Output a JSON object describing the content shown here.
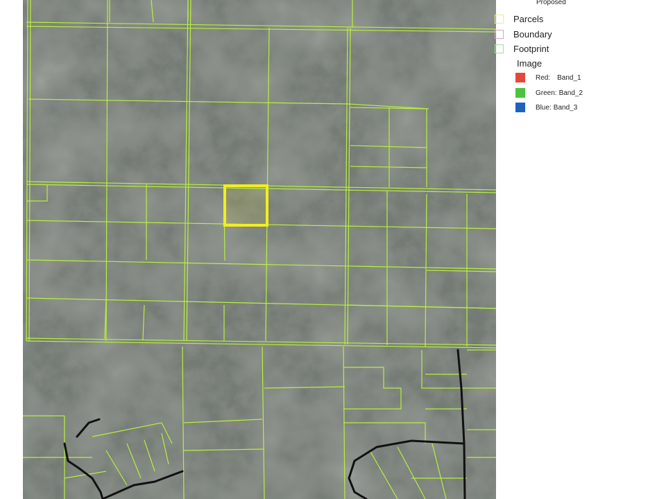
{
  "legend": {
    "title": "Proposed",
    "layers": [
      {
        "label": "Parcels",
        "color": "#eef07a"
      },
      {
        "label": "Boundary",
        "color": "#d8a4c8"
      },
      {
        "label": "Footprint",
        "color": "#9ee09e"
      }
    ],
    "image_heading": "Image",
    "bands": [
      {
        "channel": "Red:",
        "band": "Band_1",
        "color": "#e2493a"
      },
      {
        "channel": "Green:",
        "band": "Band_2",
        "color": "#4cc43c"
      },
      {
        "channel": "Blue:",
        "band": "Band_3",
        "color": "#1f62c0"
      }
    ]
  },
  "map": {
    "parcel_line_color": "#b8f03c",
    "selected_parcel_color": "#f2ee1e",
    "road_color": "#111111",
    "imagery_color": "#6f746f"
  }
}
